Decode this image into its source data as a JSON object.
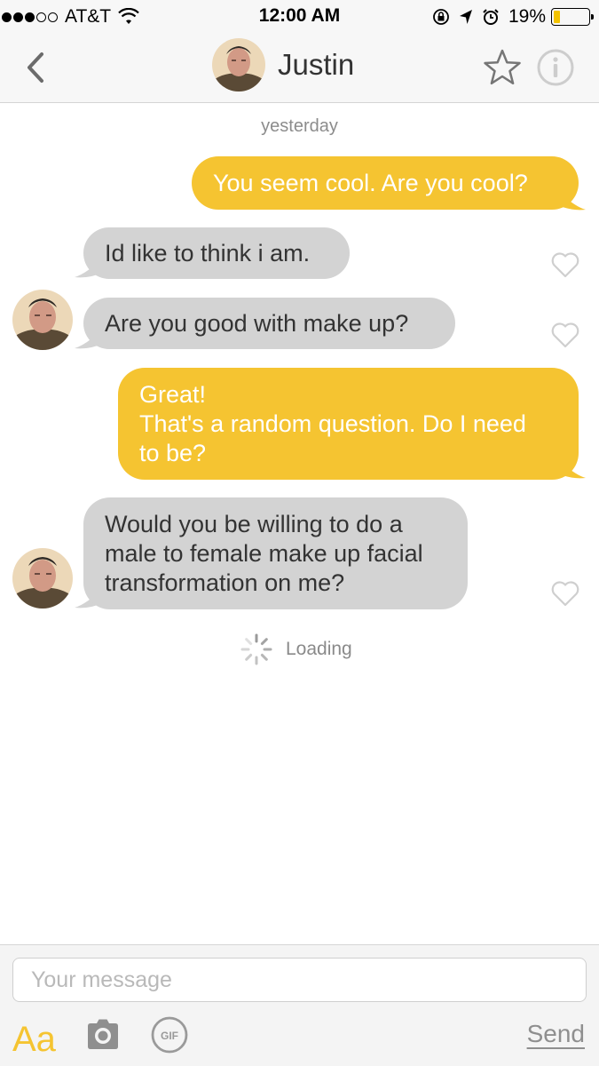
{
  "status_bar": {
    "carrier": "AT&T",
    "time": "12:00 AM",
    "battery_percent_label": "19%",
    "battery_level": 0.19,
    "signal_bars_filled": 3,
    "signal_bars_total": 5
  },
  "header": {
    "contact_name": "Justin",
    "icons": [
      "back-chevron-icon",
      "avatar",
      "star-icon",
      "info-icon"
    ]
  },
  "chat": {
    "date_label": "yesterday",
    "messages": [
      {
        "direction": "outgoing",
        "text": "You seem cool. Are you cool?"
      },
      {
        "direction": "incoming",
        "text": "Id like to think i am."
      },
      {
        "direction": "incoming",
        "text": "Are you good with make up?"
      },
      {
        "direction": "outgoing",
        "text": "Great!\nThat's a random question. Do I need\nto be?"
      },
      {
        "direction": "incoming",
        "text": "Would you be willing to do a\nmale to female make up facial\ntransformation on me?"
      }
    ],
    "loading_label": "Loading"
  },
  "composer": {
    "placeholder": "Your message",
    "value": "",
    "font_button": "Aa",
    "send_label": "Send",
    "icons": [
      "camera-icon",
      "gif-icon"
    ]
  },
  "colors": {
    "outgoing_bubble": "#f5c431",
    "incoming_bubble": "#d3d3d3",
    "accent": "#f5c431",
    "background": "#ffffff"
  }
}
